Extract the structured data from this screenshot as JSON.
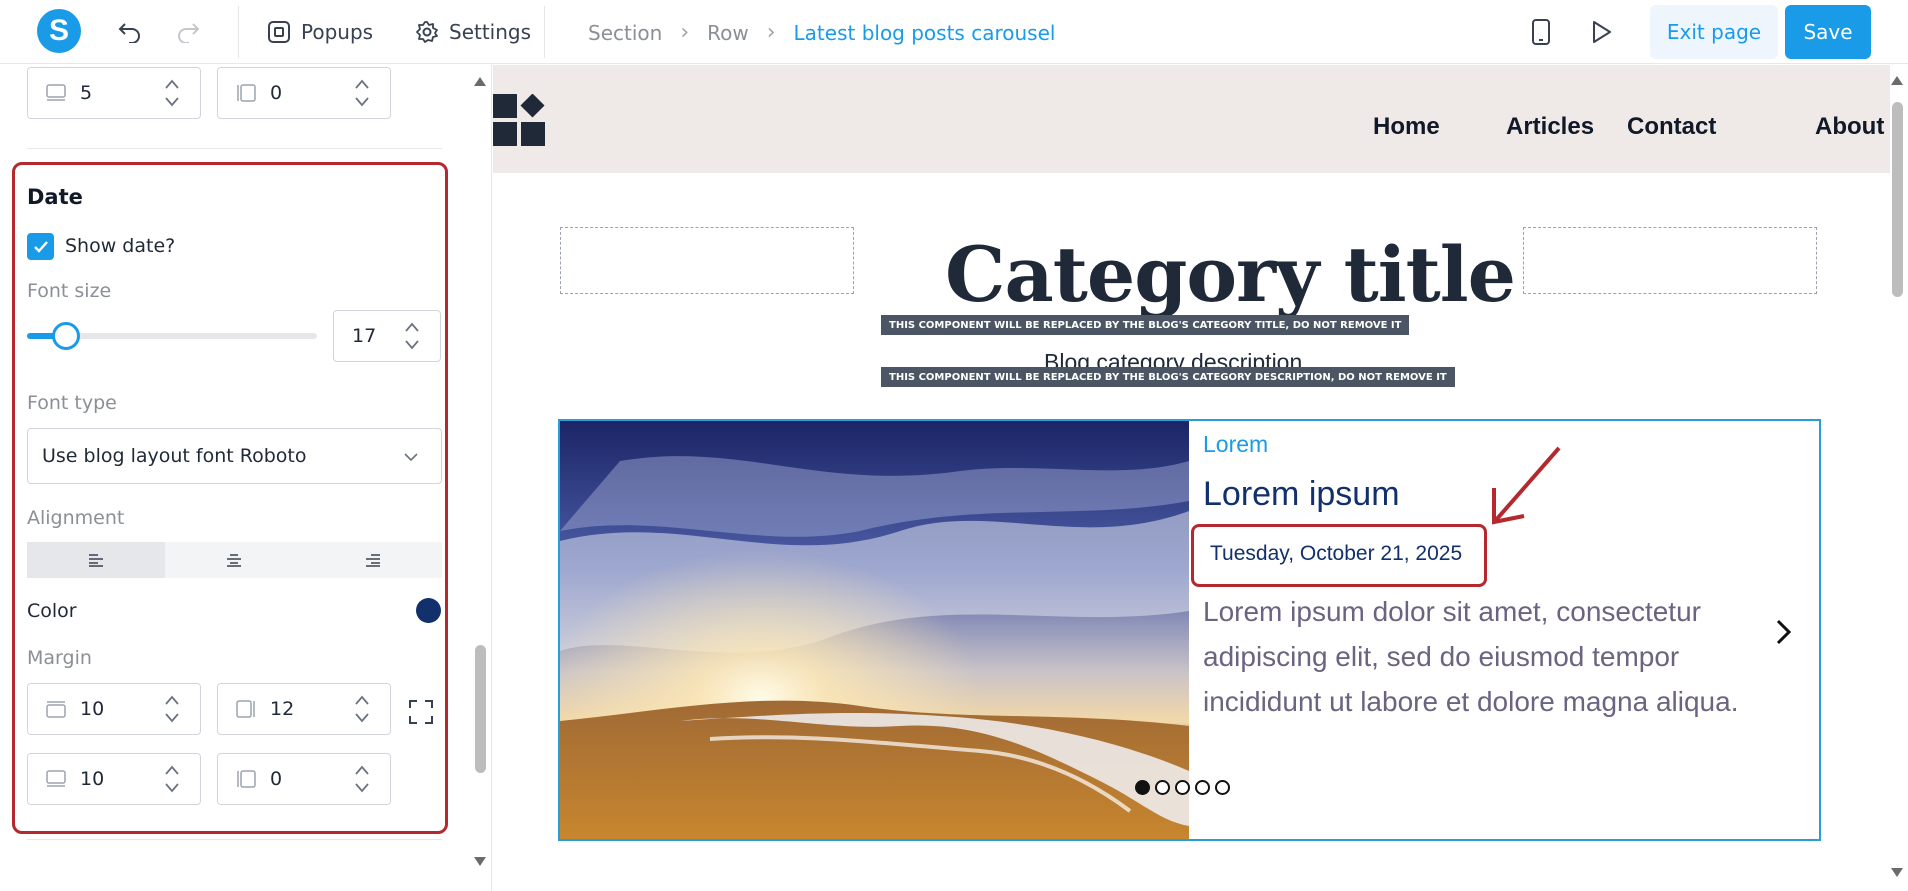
{
  "toolbar": {
    "logo_letter": "S",
    "popups_label": "Popups",
    "settings_label": "Settings",
    "breadcrumbs": [
      "Section",
      "Row",
      "Latest blog posts carousel"
    ],
    "exit_label": "Exit page",
    "save_label": "Save"
  },
  "panel": {
    "top_fields": [
      "5",
      "0"
    ],
    "date": {
      "title": "Date",
      "show_date_label": "Show date?",
      "show_date_checked": true,
      "font_size_label": "Font size",
      "font_size_value": "17",
      "font_type_label": "Font type",
      "font_type_value": "Use blog layout font Roboto",
      "alignment_label": "Alignment",
      "alignment_selected": "left",
      "color_label": "Color",
      "color_value": "#12306b",
      "margin_label": "Margin",
      "margin": {
        "top": "10",
        "right": "12",
        "bottom": "10",
        "left": "0"
      }
    }
  },
  "canvas": {
    "nav": [
      "Home",
      "Articles",
      "Contact",
      "About"
    ],
    "category_title": "Category title",
    "title_notice": "THIS COMPONENT WILL BE REPLACED BY THE BLOG'S CATEGORY TITLE, DO NOT REMOVE IT",
    "category_description": "Blog category description",
    "description_notice": "THIS COMPONENT WILL BE REPLACED BY THE BLOG'S CATEGORY DESCRIPTION, DO NOT REMOVE IT",
    "post": {
      "category": "Lorem",
      "title": "Lorem ipsum",
      "date": "Tuesday, October 21, 2025",
      "excerpt": "Lorem ipsum dolor sit amet, consectetur adipiscing elit, sed do eiusmod tempor incididunt ut labore et dolore magna aliqua."
    },
    "slide_count": 5,
    "active_slide": 1
  },
  "colors": {
    "accent": "#1a9be8",
    "highlight": "#b5282e",
    "date_color": "#12306b"
  }
}
